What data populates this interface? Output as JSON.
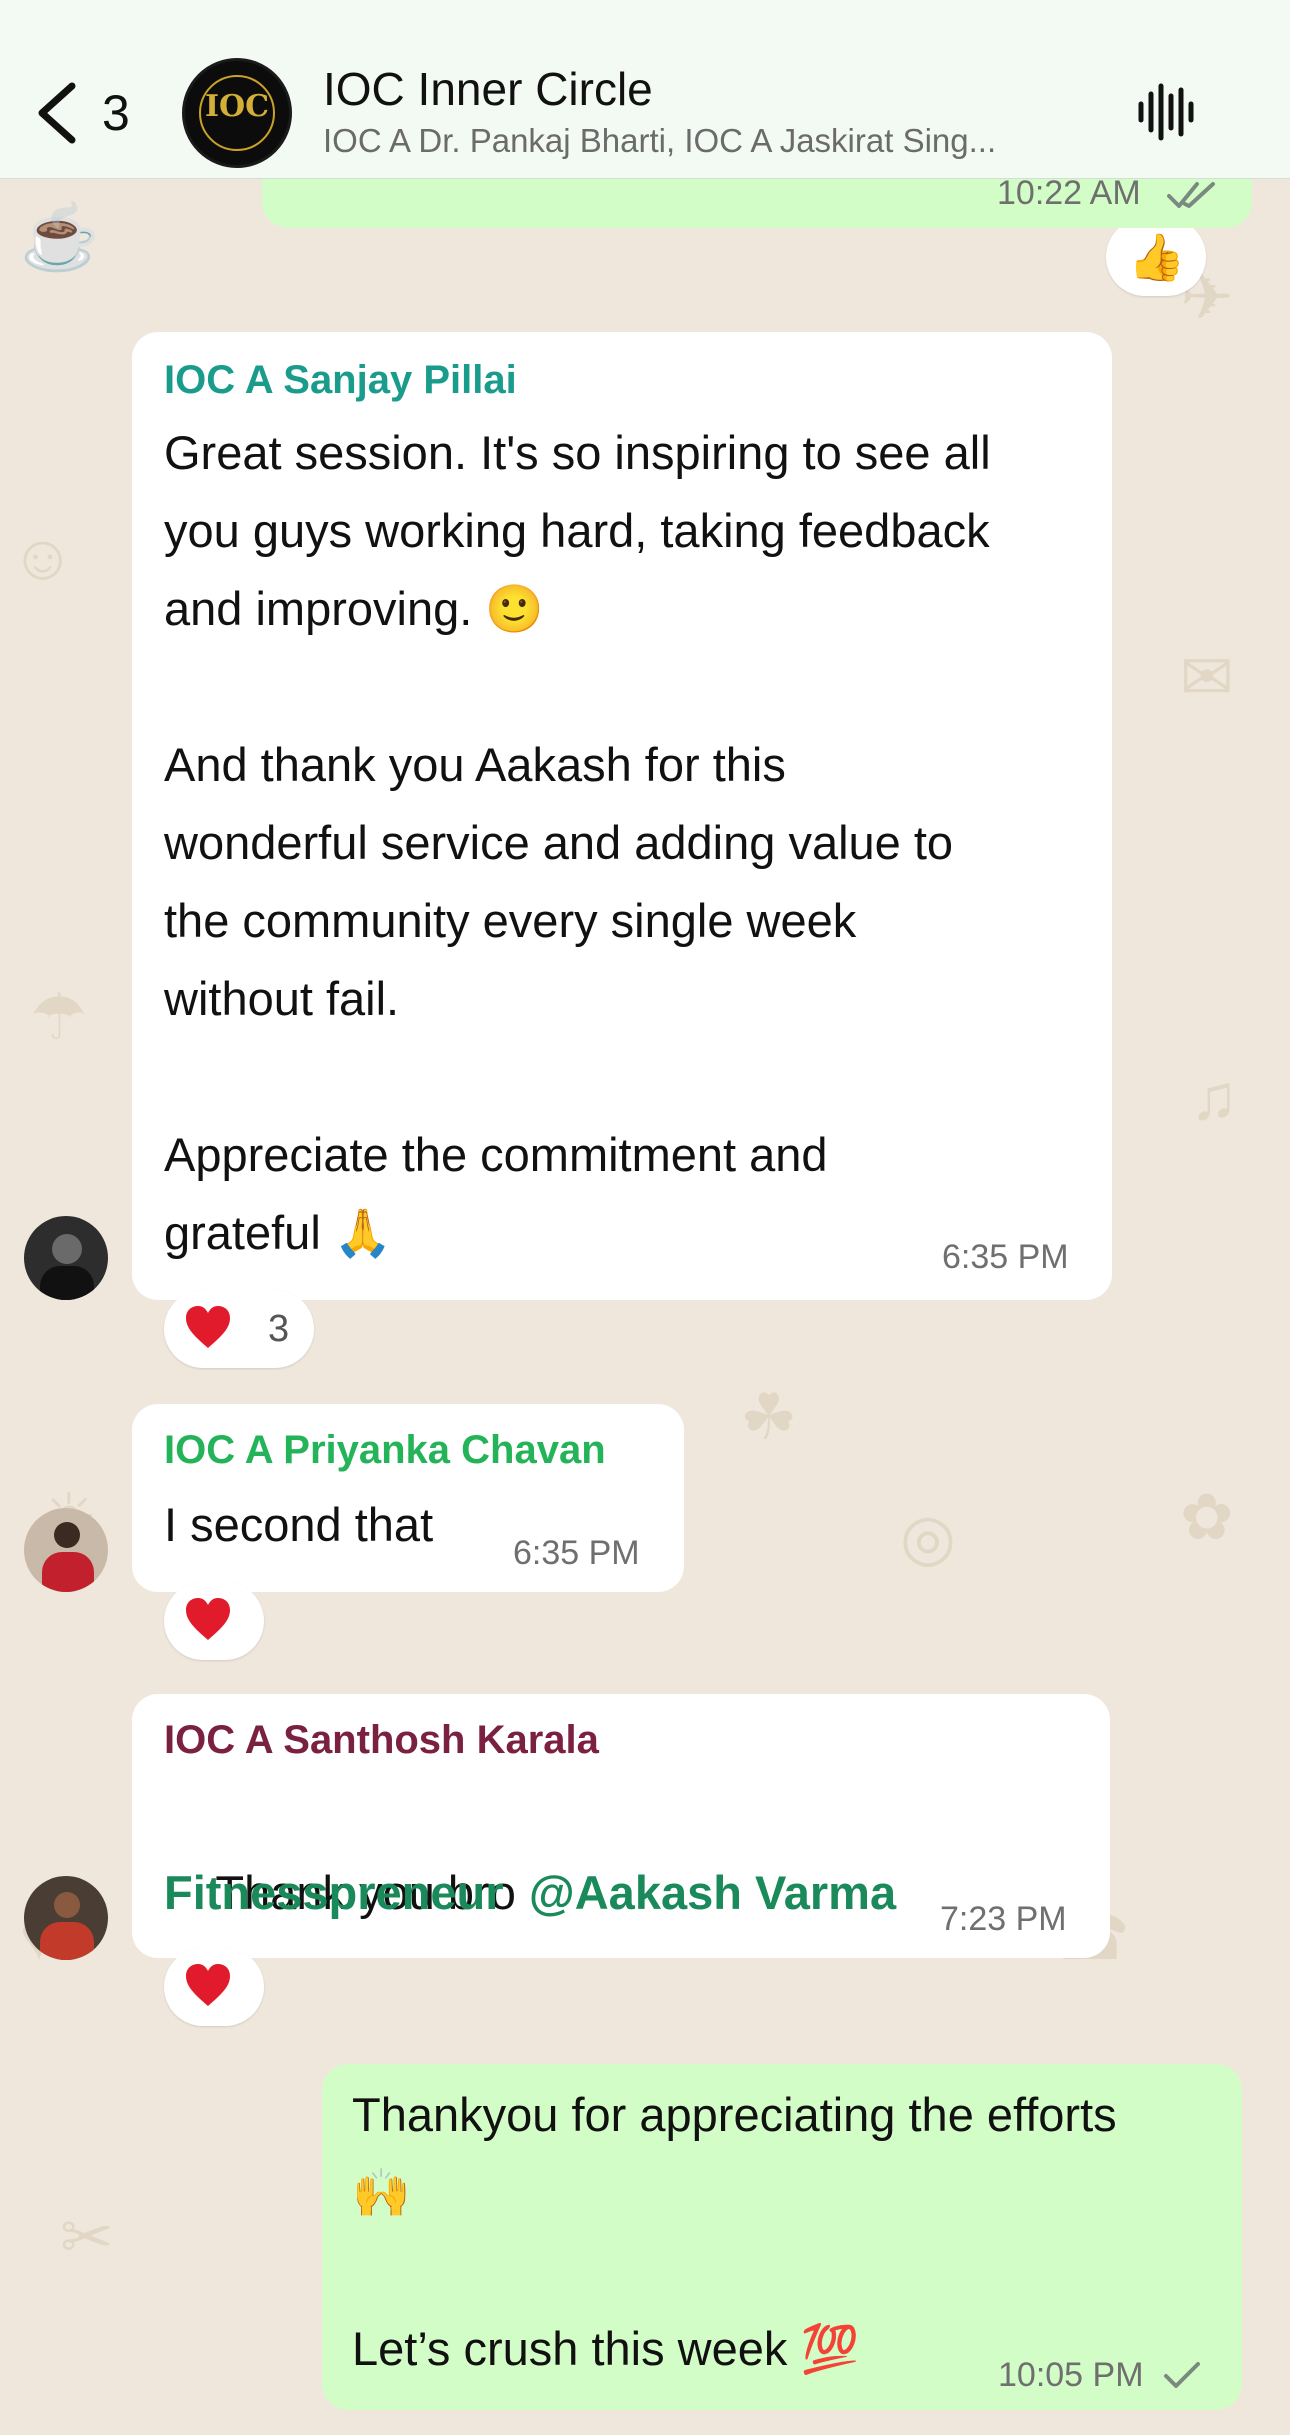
{
  "header": {
    "back_count": "3",
    "title": "IOC Inner Circle",
    "subtitle": "IOC A Dr. Pankaj Bharti, IOC A Jaskirat Sing...",
    "logo_text": "IOC"
  },
  "messages": [
    {
      "time": "10:22 AM",
      "reaction": "👍"
    },
    {
      "sender": "IOC A Sanjay Pillai",
      "sender_color": "#1a9c8c",
      "lines": [
        "Great session. It's so inspiring to see all",
        "you guys working hard, taking feedback",
        "and improving. 🙂",
        "",
        "And thank you Aakash for this",
        "wonderful service and adding value to",
        "the community every single week",
        "without fail.",
        "",
        "Appreciate the commitment and",
        "grateful 🙏"
      ],
      "time": "6:35 PM",
      "reaction_count": "3"
    },
    {
      "sender": "IOC A Priyanka Chavan",
      "sender_color": "#25b35a",
      "text": "I second that",
      "time": "6:35 PM"
    },
    {
      "sender": "IOC A Santhosh Karala",
      "sender_color": "#7a2142",
      "text_prefix": "Thank you bro ",
      "mention_line1": "@Aakash Varma",
      "mention_line2": "Fitnesspreneur",
      "time": "7:23 PM"
    },
    {
      "line1": "Thankyou for appreciating the efforts",
      "line2": "🙌",
      "line3": "Let’s crush this week 💯",
      "time": "10:05 PM"
    }
  ],
  "icons": {
    "back": "chevron-left-icon",
    "voice": "waveform-icon",
    "heart": "heart-icon",
    "read": "double-check-icon",
    "sent": "single-check-icon"
  },
  "colors": {
    "header_bg": "#f3faf3",
    "wallpaper": "#efe7dc",
    "outgoing": "#d3fdc7",
    "incoming": "#ffffff",
    "mention": "#1b8a5a"
  }
}
